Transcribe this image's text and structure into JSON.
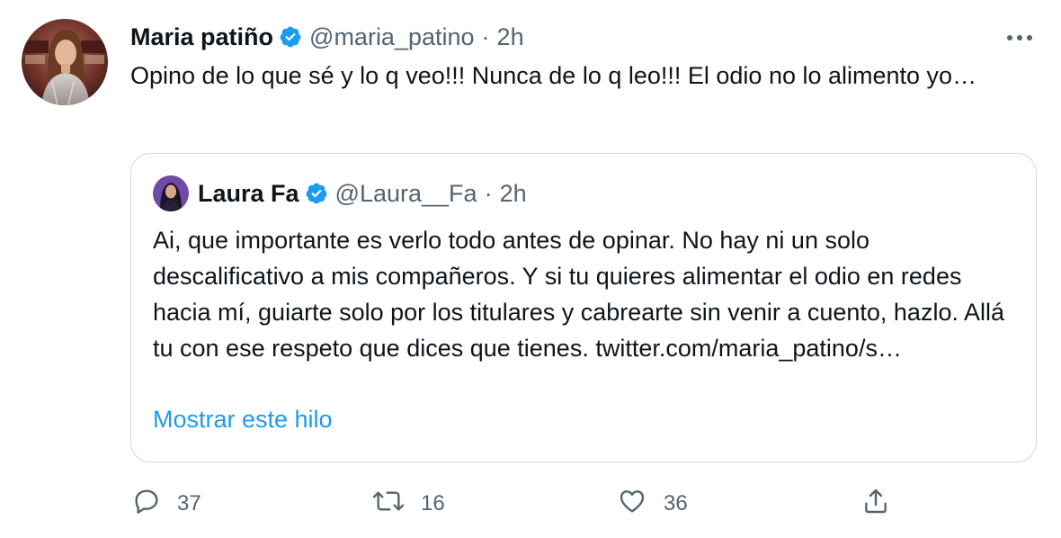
{
  "tweet": {
    "author_name": "Maria patiño",
    "author_handle": "@maria_patino",
    "separator": "·",
    "time": "2h",
    "text": "Opino de lo que sé y lo q veo!!! Nunca de lo q leo!!! El odio no lo alimento yo…"
  },
  "quoted": {
    "author_name": "Laura Fa",
    "author_handle": "@Laura__Fa",
    "separator": "·",
    "time": "2h",
    "text": "Ai, que importante es verlo todo antes de opinar. No hay ni un solo descalificativo a mis compañeros. Y si tu quieres alimentar el odio en redes hacia mí, guiarte solo por los titulares y cabrearte sin venir a cuento, hazlo. Allá tu con ese respeto que dices que tienes. twitter.com/maria_patino/s…",
    "show_thread_label": "Mostrar este hilo"
  },
  "actions": {
    "reply_count": "37",
    "retweet_count": "16",
    "like_count": "36"
  },
  "icons": {
    "verified": "verified-badge-icon",
    "more": "more-options-icon",
    "reply": "reply-icon",
    "retweet": "retweet-icon",
    "like": "heart-icon",
    "share": "share-icon"
  },
  "colors": {
    "text": "#0f1419",
    "secondary": "#536471",
    "accent": "#1d9bf0",
    "border": "#cfd9de"
  }
}
